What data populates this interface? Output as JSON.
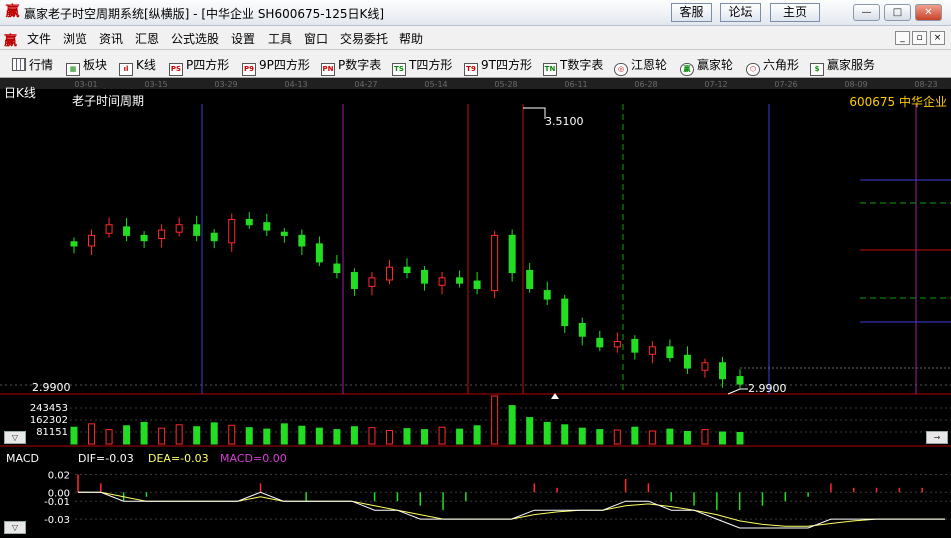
{
  "window": {
    "app_logo": "赢",
    "title": "赢家老子时空周期系统[纵横版] - [中华企业  SH600675-125日K线]",
    "links": [
      "客服",
      "论坛",
      "主页"
    ],
    "controls": {
      "minimize": "—",
      "maximize": "□",
      "close": "✕"
    }
  },
  "menubar": {
    "logo": "赢",
    "items": [
      "文件",
      "浏览",
      "资讯",
      "汇恩",
      "公式选股",
      "设置",
      "工具",
      "窗口",
      "交易委托",
      "帮助"
    ],
    "mdi": {
      "minimize": "_",
      "restore": "▫",
      "close": "×"
    }
  },
  "toolbar": {
    "items": [
      {
        "label": "行情",
        "icon": "grid-icon",
        "glyph": ""
      },
      {
        "label": "板块",
        "icon": "blocks-icon",
        "glyph": "▦"
      },
      {
        "label": "K线",
        "icon": "candles-icon",
        "glyph": "ıl"
      },
      {
        "label": "P四方形",
        "icon": "ps-icon",
        "glyph": "PS"
      },
      {
        "label": "9P四方形",
        "icon": "p9-icon",
        "glyph": "P9"
      },
      {
        "label": "P数字表",
        "icon": "pn-icon",
        "glyph": "PN"
      },
      {
        "label": "T四方形",
        "icon": "ts-icon",
        "glyph": "TS"
      },
      {
        "label": "9T四方形",
        "icon": "t9-icon",
        "glyph": "T9"
      },
      {
        "label": "T数字表",
        "icon": "tn-icon",
        "glyph": "TN"
      },
      {
        "label": "江恩轮",
        "icon": "gann-wheel-icon",
        "glyph": "◎"
      },
      {
        "label": "赢家轮",
        "icon": "winner-wheel-icon",
        "glyph": "赢"
      },
      {
        "label": "六角形",
        "icon": "hexagon-icon",
        "glyph": "⬡"
      },
      {
        "label": "赢家服务",
        "icon": "dollar-icon",
        "glyph": "$"
      }
    ]
  },
  "chart_header": {
    "period": "日K线",
    "title": "老子时间周期",
    "stock": "600675  中华企业"
  },
  "colors": {
    "up": "#ff2a2a",
    "down": "#22dd22",
    "accent": "#ffcc00",
    "dif": "#ffffff",
    "dea": "#ffff66",
    "macd": "#d83cd8"
  },
  "chart_data": [
    {
      "type": "candlestick",
      "title": "老子时间周期",
      "x_dates": [
        "03-01",
        "03-15",
        "03-29",
        "04-13",
        "04-27",
        "05-14",
        "05-28",
        "06-11",
        "06-28",
        "07-12",
        "07-26",
        "08-09",
        "08-23"
      ],
      "annotations": {
        "high": "3.5100",
        "low": "2.9900"
      },
      "price_axis_label": "2.9900",
      "trend": [
        3.25,
        3.27,
        3.29,
        3.27,
        3.26,
        3.28,
        3.29,
        3.27,
        3.26,
        3.3,
        3.29,
        3.28,
        3.27,
        3.25,
        3.22,
        3.2,
        3.17,
        3.19,
        3.21,
        3.2,
        3.18,
        3.19,
        3.18,
        3.17,
        3.27,
        3.2,
        3.17,
        3.15,
        3.1,
        3.08,
        3.06,
        3.07,
        3.05,
        3.06,
        3.04,
        3.02,
        3.03,
        3.0,
        2.99
      ],
      "volume_axis": [
        "243453",
        "162302",
        "81151"
      ],
      "volume_profile": [
        0.35,
        0.42,
        0.3,
        0.38,
        0.45,
        0.33,
        0.4,
        0.36,
        0.44,
        0.39,
        0.34,
        0.31,
        0.42,
        0.37,
        0.33,
        0.3,
        0.36,
        0.34,
        0.28,
        0.32,
        0.3,
        0.35,
        0.31,
        0.38,
        1.0,
        0.8,
        0.55,
        0.45,
        0.4,
        0.33,
        0.3,
        0.29,
        0.35,
        0.27,
        0.31,
        0.26,
        0.3,
        0.25,
        0.24
      ]
    },
    {
      "type": "bar",
      "title": "MACD",
      "series": [
        {
          "name": "DIF",
          "last": "-0.03"
        },
        {
          "name": "DEA",
          "last": "-0.03"
        },
        {
          "name": "MACD",
          "last": "0.00"
        }
      ],
      "y_ticks": [
        "0.02",
        "0.00",
        "-0.01",
        "-0.03"
      ],
      "dif": [
        0.0,
        0.0,
        -0.01,
        -0.01,
        -0.01,
        -0.01,
        -0.01,
        -0.01,
        0.0,
        -0.01,
        -0.01,
        -0.01,
        -0.01,
        -0.02,
        -0.02,
        -0.03,
        -0.03,
        -0.03,
        -0.03,
        -0.03,
        -0.02,
        -0.02,
        -0.02,
        -0.02,
        -0.01,
        -0.01,
        -0.02,
        -0.02,
        -0.03,
        -0.04,
        -0.04,
        -0.04,
        -0.04,
        -0.03,
        -0.03,
        -0.03,
        -0.03,
        -0.03,
        -0.03
      ],
      "dea": [
        0.0,
        0.0,
        -0.005,
        -0.01,
        -0.01,
        -0.01,
        -0.01,
        -0.01,
        -0.005,
        -0.01,
        -0.01,
        -0.01,
        -0.01,
        -0.015,
        -0.02,
        -0.025,
        -0.03,
        -0.03,
        -0.03,
        -0.03,
        -0.025,
        -0.022,
        -0.02,
        -0.02,
        -0.015,
        -0.013,
        -0.016,
        -0.02,
        -0.025,
        -0.032,
        -0.036,
        -0.038,
        -0.038,
        -0.035,
        -0.032,
        -0.03,
        -0.03,
        -0.03,
        -0.03
      ],
      "macd_bars": [
        0.02,
        0.01,
        -0.01,
        -0.005,
        0.0,
        0.0,
        0.0,
        0.0,
        0.01,
        0.0,
        -0.01,
        0.0,
        0.0,
        -0.01,
        -0.01,
        -0.015,
        -0.02,
        -0.01,
        0.0,
        0.0,
        0.01,
        0.005,
        0.0,
        0.0,
        0.015,
        0.01,
        -0.01,
        -0.015,
        -0.02,
        -0.02,
        -0.015,
        -0.01,
        -0.005,
        0.01,
        0.005,
        0.005,
        0.005,
        0.005,
        0.0
      ]
    }
  ]
}
